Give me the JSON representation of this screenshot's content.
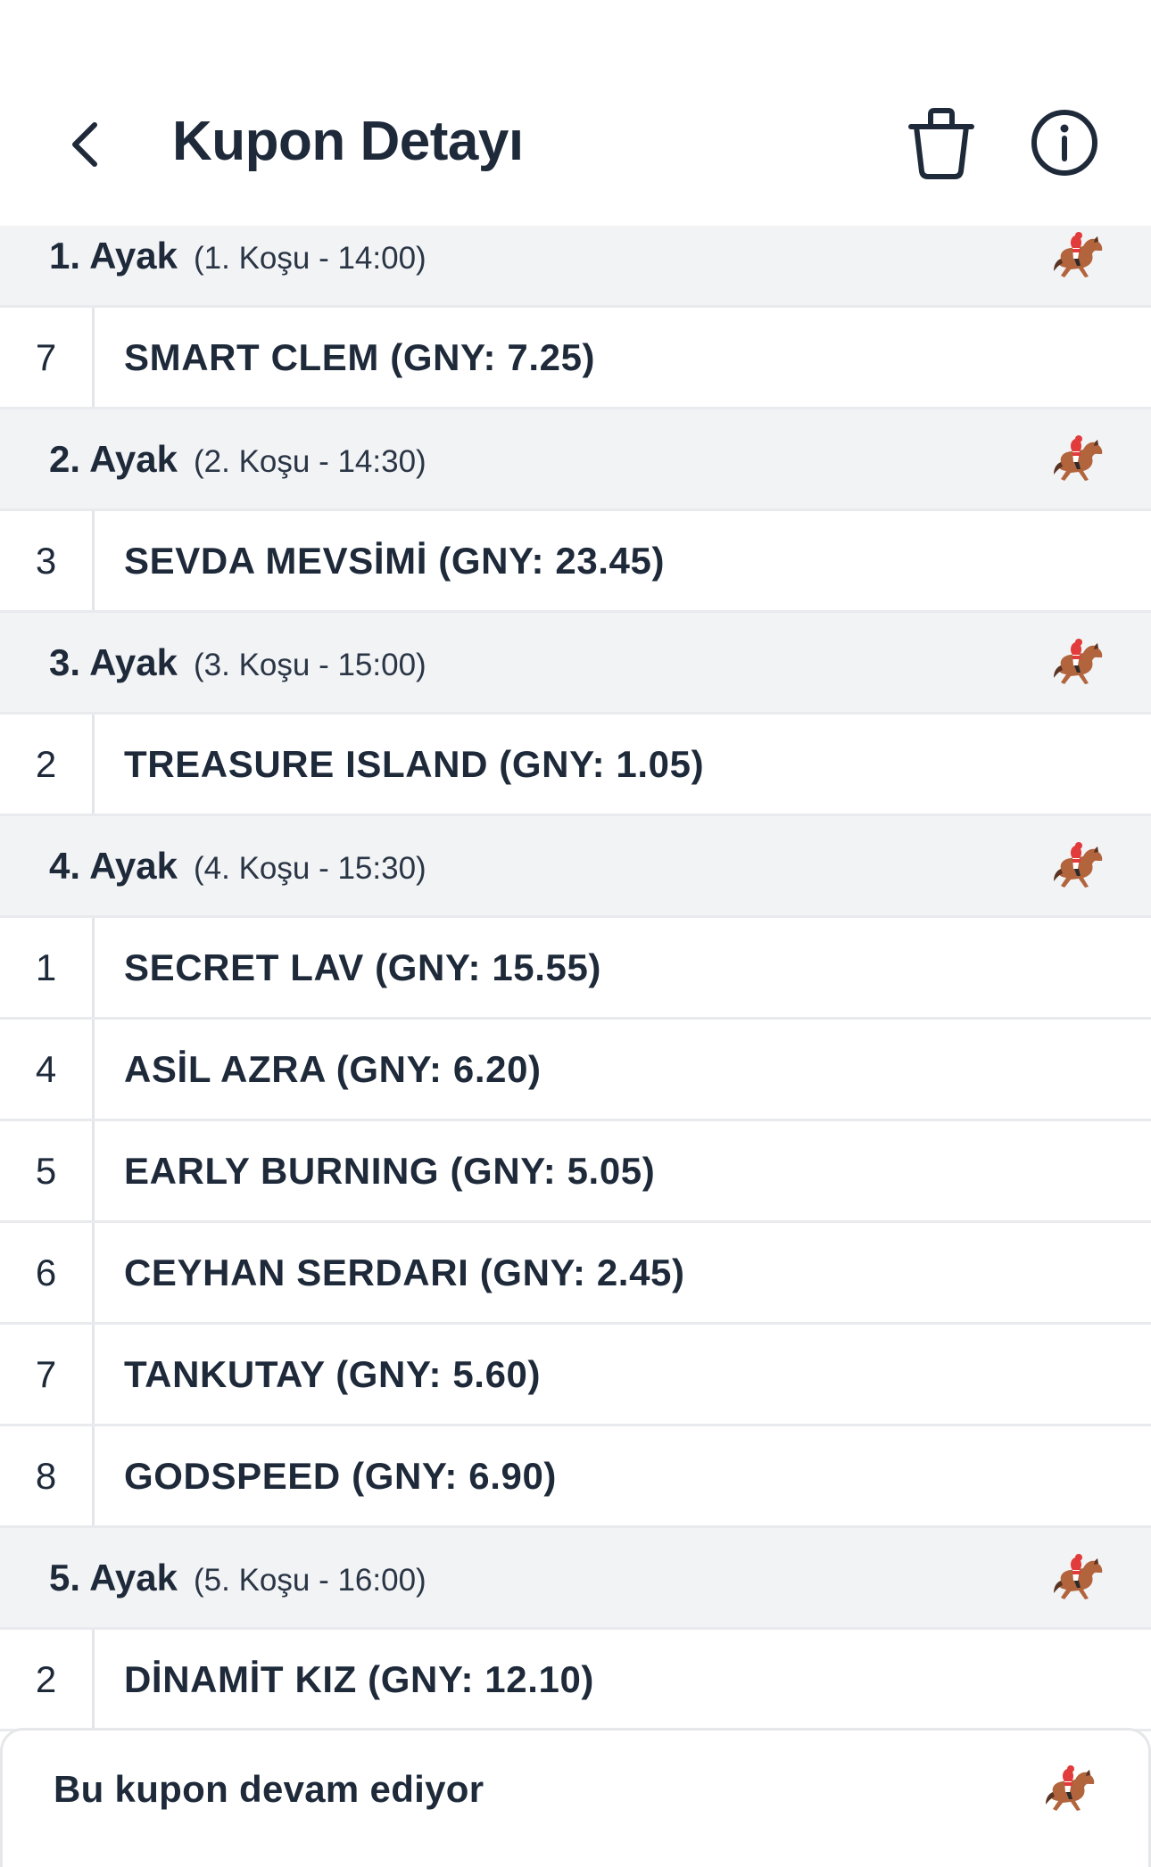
{
  "header": {
    "title": "Kupon Detayı",
    "back_icon": "chevron-left-icon",
    "trash_icon": "trash-icon",
    "info_icon": "info-icon"
  },
  "legs": [
    {
      "name": "1. Ayak",
      "info": "(1. Koşu - 14:00)",
      "icon": "horse-racing-icon",
      "runners": [
        {
          "no": "7",
          "name": "SMART CLEM (GNY: 7.25)"
        }
      ]
    },
    {
      "name": "2. Ayak",
      "info": "(2. Koşu - 14:30)",
      "icon": "horse-racing-icon",
      "runners": [
        {
          "no": "3",
          "name": "SEVDA MEVSİMİ (GNY: 23.45)"
        }
      ]
    },
    {
      "name": "3. Ayak",
      "info": "(3. Koşu - 15:00)",
      "icon": "horse-racing-icon",
      "runners": [
        {
          "no": "2",
          "name": "TREASURE ISLAND (GNY: 1.05)"
        }
      ]
    },
    {
      "name": "4. Ayak",
      "info": "(4. Koşu - 15:30)",
      "icon": "horse-racing-icon",
      "runners": [
        {
          "no": "1",
          "name": "SECRET LAV (GNY: 15.55)"
        },
        {
          "no": "4",
          "name": "ASİL AZRA (GNY: 6.20)"
        },
        {
          "no": "5",
          "name": "EARLY BURNING (GNY: 5.05)"
        },
        {
          "no": "6",
          "name": "CEYHAN SERDARI (GNY: 2.45)"
        },
        {
          "no": "7",
          "name": "TANKUTAY (GNY: 5.60)"
        },
        {
          "no": "8",
          "name": "GODSPEED (GNY: 6.90)"
        }
      ]
    },
    {
      "name": "5. Ayak",
      "info": "(5. Koşu - 16:00)",
      "icon": "horse-racing-icon",
      "runners": [
        {
          "no": "2",
          "name": "DİNAMİT KIZ (GNY: 12.10)"
        }
      ]
    }
  ],
  "footer": {
    "status": "Bu kupon devam ediyor",
    "icon": "horse-racing-icon"
  },
  "colors": {
    "text": "#1e2a3a",
    "leg_background": "#f2f3f5",
    "divider": "#e9eaed"
  }
}
